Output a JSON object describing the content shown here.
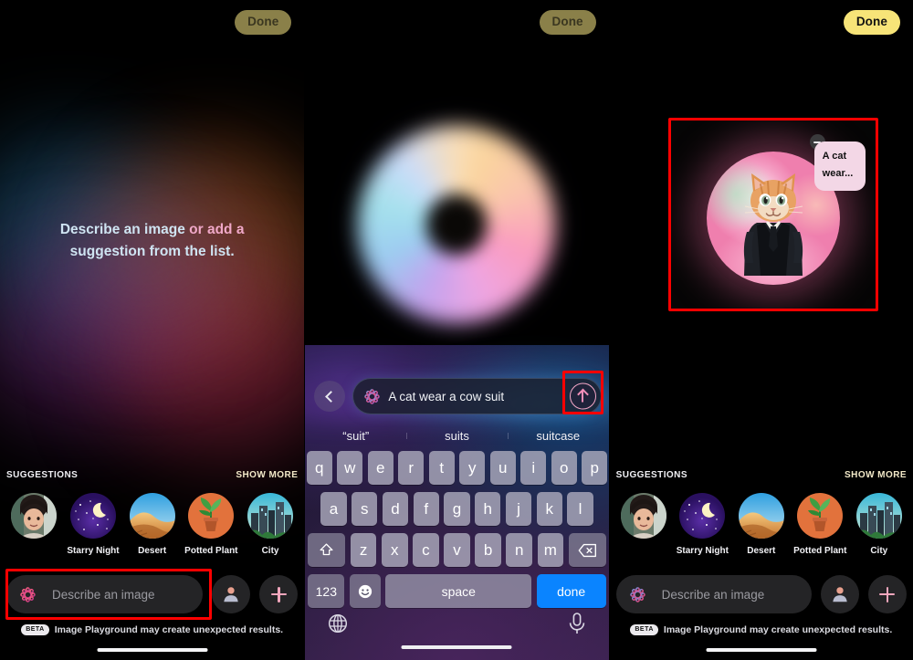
{
  "app": {
    "name": "Image Playground",
    "screens": 3
  },
  "panel1": {
    "done_label": "Done",
    "headline_line1_a": "Describe an image",
    "headline_line1_b": " or add a",
    "headline_line2": "suggestion from the list.",
    "suggestions": {
      "title": "SUGGESTIONS",
      "show_more": "SHOW MORE",
      "items": [
        {
          "label": "",
          "icon": "person-photo-thumb"
        },
        {
          "label": "Starry Night",
          "icon": "starry-night-thumb"
        },
        {
          "label": "Desert",
          "icon": "desert-thumb"
        },
        {
          "label": "Potted Plant",
          "icon": "potted-plant-thumb"
        },
        {
          "label": "City",
          "icon": "city-thumb"
        }
      ]
    },
    "input": {
      "placeholder": "Describe an image",
      "icon": "apple-intelligence-icon"
    },
    "person_button_icon": "person-icon",
    "add_button_icon": "plus-icon",
    "beta_badge": "BETA",
    "beta_text": "Image Playground may create unexpected results.",
    "highlight_color": "#ff0000"
  },
  "panel2": {
    "done_label": "Done",
    "loading_orb_icon": "generating-orb",
    "back_icon": "chevron-left-icon",
    "field_value": "A cat wear a cow suit",
    "field_icon": "apple-intelligence-icon",
    "send_icon": "arrow-up-circle-icon",
    "send_highlighted": true,
    "autocorrect": [
      "“suit”",
      "suits",
      "suitcase"
    ],
    "keyboard": {
      "row1": [
        "q",
        "w",
        "e",
        "r",
        "t",
        "y",
        "u",
        "i",
        "o",
        "p"
      ],
      "row2": [
        "a",
        "s",
        "d",
        "f",
        "g",
        "h",
        "j",
        "k",
        "l"
      ],
      "row3_shift_icon": "shift-icon",
      "row3": [
        "z",
        "x",
        "c",
        "v",
        "b",
        "n",
        "m"
      ],
      "row3_delete_icon": "delete-icon",
      "numbers_key": "123",
      "emoji_key_icon": "emoji-icon",
      "space_key": "space",
      "return_key": "done",
      "globe_icon": "globe-icon",
      "mic_icon": "microphone-icon",
      "return_key_color": "#0a84ff"
    }
  },
  "panel3": {
    "done_label": "Done",
    "done_active": true,
    "result_image_icon": "cat-in-suit-image",
    "tag_chip_line1": "A cat",
    "tag_chip_line2": "wear...",
    "tag_remove_icon": "minus-circle-icon",
    "result_highlighted": true,
    "suggestions": {
      "title": "SUGGESTIONS",
      "show_more": "SHOW MORE",
      "items": [
        {
          "label": "",
          "icon": "person-photo-thumb"
        },
        {
          "label": "Starry Night",
          "icon": "starry-night-thumb"
        },
        {
          "label": "Desert",
          "icon": "desert-thumb"
        },
        {
          "label": "Potted Plant",
          "icon": "potted-plant-thumb"
        },
        {
          "label": "City",
          "icon": "city-thumb"
        }
      ]
    },
    "input": {
      "placeholder": "Describe an image",
      "icon": "apple-intelligence-icon"
    },
    "person_button_icon": "person-icon",
    "add_button_icon": "plus-icon",
    "beta_badge": "BETA",
    "beta_text": "Image Playground may create unexpected results."
  }
}
